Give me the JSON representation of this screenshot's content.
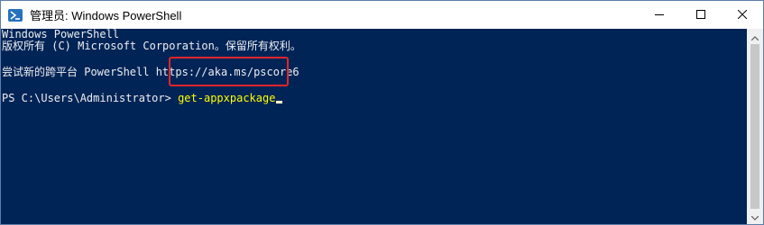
{
  "window": {
    "title": "管理员: Windows PowerShell",
    "icon": "powershell-icon",
    "controls": [
      "minimize-icon",
      "maximize-icon",
      "close-icon"
    ]
  },
  "console": {
    "lines": [
      "Windows PowerShell",
      "版权所有 (C) Microsoft Corporation。保留所有权利。",
      "",
      "尝试新的跨平台 PowerShell https://aka.ms/pscore6",
      ""
    ],
    "prompt": "PS C:\\Users\\Administrator> ",
    "command": "get-appxpackage"
  },
  "colors": {
    "console_background": "#012456",
    "console_text": "#eeedf0",
    "command_text": "#ffff00",
    "highlight_border": "#e0262b"
  }
}
